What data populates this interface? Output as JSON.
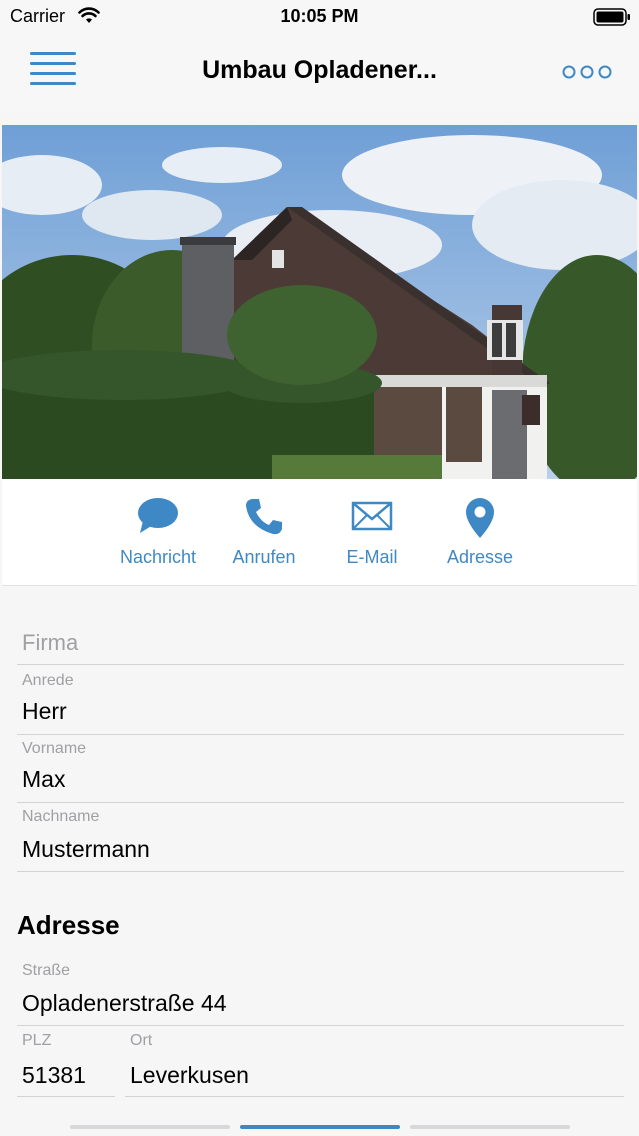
{
  "status_bar": {
    "carrier": "Carrier",
    "time": "10:05 PM"
  },
  "nav": {
    "title": "Umbau Opladener...",
    "menu_icon": "hamburger-icon",
    "more_icon": "more-dots-icon"
  },
  "hero": {
    "alt": "house-photo"
  },
  "actions": [
    {
      "label": "Nachricht",
      "icon": "chat-bubble-icon"
    },
    {
      "label": "Anrufen",
      "icon": "phone-icon"
    },
    {
      "label": "E-Mail",
      "icon": "envelope-icon"
    },
    {
      "label": "Adresse",
      "icon": "map-pin-icon"
    }
  ],
  "form": {
    "company_placeholder": "Firma",
    "salutation": {
      "label": "Anrede",
      "value": "Herr"
    },
    "first_name": {
      "label": "Vorname",
      "value": "Max"
    },
    "last_name": {
      "label": "Nachname",
      "value": "Mustermann"
    }
  },
  "address": {
    "section_title": "Adresse",
    "street": {
      "label": "Straße",
      "value": "Opladenerstraße 44"
    },
    "zip": {
      "label": "PLZ",
      "value": "51381"
    },
    "city": {
      "label": "Ort",
      "value": "Leverkusen"
    }
  },
  "pager": {
    "pages": 3,
    "active": 1
  },
  "colors": {
    "accent": "#3f88c6",
    "label": "#a0a0a4",
    "divider": "#d3d3d6"
  }
}
